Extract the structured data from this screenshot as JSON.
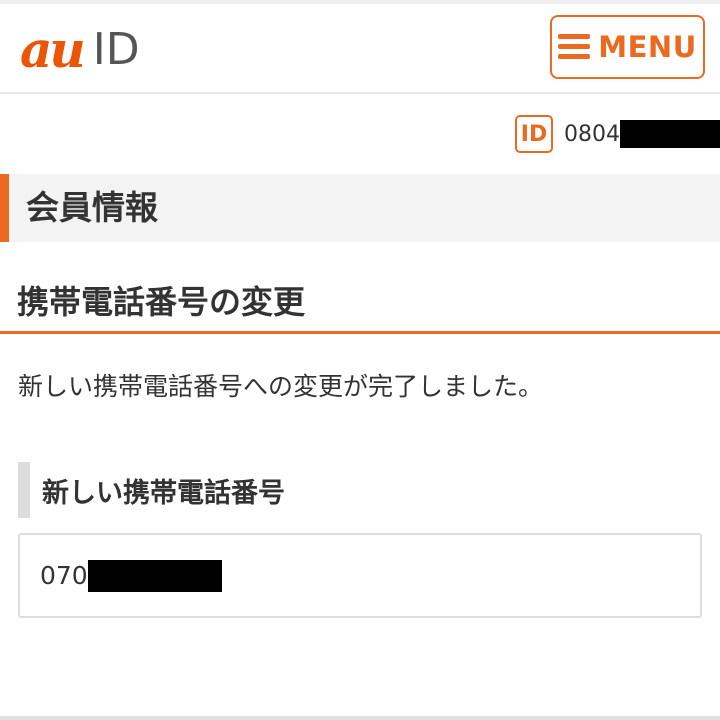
{
  "header": {
    "logo_au": "au",
    "logo_id": "ID",
    "menu_label": "MENU",
    "menu_icon": "hamburger-icon",
    "accent_color": "#eb6a1f"
  },
  "account": {
    "id_badge": "ID",
    "id_number_visible": "0804",
    "id_number_redacted": true
  },
  "page": {
    "section_title": "会員情報",
    "heading": "携帯電話番号の変更",
    "message": "新しい携帯電話番号への変更が完了しました。",
    "field_label": "新しい携帯電話番号",
    "phone_visible": "070",
    "phone_redacted": true
  }
}
